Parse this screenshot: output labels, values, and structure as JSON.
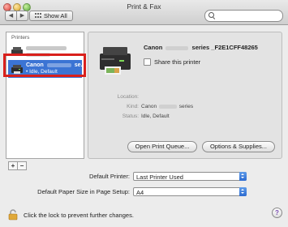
{
  "window": {
    "title": "Print & Fax"
  },
  "toolbar": {
    "back": "◀",
    "forward": "▶",
    "show_all": "Show All",
    "search_placeholder": ""
  },
  "printers": {
    "header": "Printers",
    "items": [
      {
        "name": "",
        "status": ""
      },
      {
        "name": "Canon",
        "name_suffix": "se...",
        "status": "• Idle, Default"
      }
    ]
  },
  "list_controls": {
    "add": "+",
    "remove": "−"
  },
  "detail": {
    "name_prefix": "Canon",
    "name_suffix": "series _F2E1CFF48265",
    "share_label": "Share this printer",
    "location_label": "Location:",
    "location_value": "",
    "kind_label": "Kind:",
    "kind_prefix": "Canon",
    "kind_suffix": "series",
    "status_label": "Status:",
    "status_value": "Idle, Default",
    "open_queue_button": "Open Print Queue...",
    "options_button": "Options & Supplies..."
  },
  "defaults": {
    "default_printer_label": "Default Printer:",
    "default_printer_value": "Last Printer Used",
    "paper_size_label": "Default Paper Size in Page Setup:",
    "paper_size_value": "A4"
  },
  "footer": {
    "lock_text": "Click the lock to prevent further changes.",
    "help": "?"
  },
  "colors": {
    "selection": "#3b74d4",
    "highlight_box": "#d9201c"
  }
}
